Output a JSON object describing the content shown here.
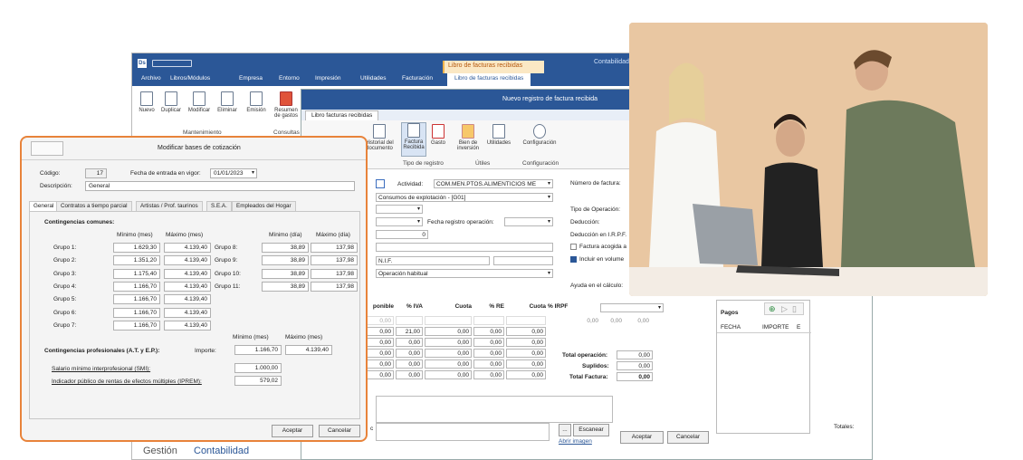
{
  "app": {
    "title": "Contabilidad",
    "context_group": "Libro de facturas recibidas",
    "ribbon_tabs": [
      "Archivo",
      "Libros/Módulos",
      "Empresa",
      "Entorno",
      "Impresión",
      "Utilidades",
      "Facturación",
      "Libro de facturas recibidas"
    ],
    "ribbon_buttons": [
      {
        "label": "Nuevo",
        "icon": "new-doc-icon"
      },
      {
        "label": "Duplicar",
        "icon": "duplicate-icon"
      },
      {
        "label": "Modificar",
        "icon": "edit-icon"
      },
      {
        "label": "Eliminar",
        "icon": "delete-icon"
      },
      {
        "label": "Emisión",
        "icon": "print-icon"
      },
      {
        "label": "Resumen de gastos",
        "icon": "summary-icon"
      }
    ],
    "ribbon_groups": [
      "Mantenimiento",
      "Consultas"
    ],
    "bottom_nav": [
      "Gestión",
      "Contabilidad"
    ]
  },
  "invoice_dialog": {
    "title": "Nuevo registro de factura recibida",
    "tab": "Libro facturas recibidas",
    "ribbon_buttons": [
      {
        "label": "Historial del documento"
      },
      {
        "label": "Factura Recibida"
      },
      {
        "label": "Gasto"
      },
      {
        "label": "Bien de inversión"
      },
      {
        "label": "Utilidades"
      },
      {
        "label": "Configuración"
      }
    ],
    "ribbon_groups": [
      "Tipo de registro",
      "Útiles",
      "Configuración"
    ],
    "actividad_label": "Actividad:",
    "actividad_value": "COM.MEN.PTOS.ALIMENTICIOS ME",
    "concepto_value": "Consumos de explotación - [G01]",
    "fecha_reg_label": "Fecha registro operación:",
    "zero_value": "0",
    "nif_label": "N.I.F.",
    "operacion_value": "Operación habitual",
    "numero_factura_label": "Número de factura:",
    "tipo_operacion_label": "Tipo de Operación:",
    "deduccion_label": "Deducción:",
    "deduccion_irpf_label": "Deducción en I.R.P.F.",
    "factura_acogida_label": "Factura acogida a",
    "incluir_label": "Incluir en volume",
    "ayuda_label": "Ayuda en el cálculo:",
    "tax_headers": [
      "ponible",
      "% IVA",
      "Cuota",
      "% RE",
      "Cuota",
      "% IRPF"
    ],
    "tax_rows": [
      [
        "0,00",
        "",
        "",
        "",
        "",
        ""
      ],
      [
        "0,00",
        "21,00",
        "0,00",
        "0,00",
        "0,00",
        ""
      ],
      [
        "0,00",
        "0,00",
        "0,00",
        "0,00",
        "0,00",
        ""
      ],
      [
        "0,00",
        "0,00",
        "0,00",
        "0,00",
        "0,00",
        ""
      ],
      [
        "0,00",
        "0,00",
        "0,00",
        "0,00",
        "0,00",
        ""
      ],
      [
        "0,00",
        "0,00",
        "0,00",
        "0,00",
        "0,00",
        ""
      ]
    ],
    "irpf_values": [
      "0,00",
      "0,00",
      "0,00"
    ],
    "totals": [
      {
        "label": "Total operación:",
        "value": "0,00"
      },
      {
        "label": "Suplidos:",
        "value": "0,00"
      },
      {
        "label": "Total Factura:",
        "value": "0,00"
      }
    ],
    "pagos_title": "Pagos",
    "pagos_headers": [
      "FECHA",
      "IMPORTE",
      "E"
    ],
    "totales_label": "Totales:",
    "escanear_label": "Escanear",
    "abrir_imagen_label": "Abrir imagen",
    "ellipsis_label": "...",
    "c_label": "c",
    "aceptar_label": "Aceptar",
    "cancelar_label": "Cancelar"
  },
  "bases_dialog": {
    "title": "Modificar bases de cotización",
    "codigo_label": "Código:",
    "codigo_value": "17",
    "fecha_label": "Fecha de entrada en vigor:",
    "fecha_value": "01/01/2023",
    "descripcion_label": "Descripción:",
    "descripcion_value": "General",
    "tabs": [
      "General",
      "Contratos a tiempo parcial",
      "Artistas / Prof. taurinos",
      "S.E.A.",
      "Empleados del Hogar"
    ],
    "comunes_title": "Contingencias comunes:",
    "col_min_mes": "Mínimo (mes)",
    "col_max_mes": "Máximo (mes)",
    "col_min_dia": "Mínimo (día)",
    "col_max_dia": "Máximo (día)",
    "grupos_mes": [
      {
        "label": "Grupo 1:",
        "min": "1.629,30",
        "max": "4.139,40"
      },
      {
        "label": "Grupo 2:",
        "min": "1.351,20",
        "max": "4.139,40"
      },
      {
        "label": "Grupo 3:",
        "min": "1.175,40",
        "max": "4.139,40"
      },
      {
        "label": "Grupo 4:",
        "min": "1.166,70",
        "max": "4.139,40"
      },
      {
        "label": "Grupo 5:",
        "min": "1.166,70",
        "max": "4.139,40"
      },
      {
        "label": "Grupo 6:",
        "min": "1.166,70",
        "max": "4.139,40"
      },
      {
        "label": "Grupo 7:",
        "min": "1.166,70",
        "max": "4.139,40"
      }
    ],
    "grupos_dia": [
      {
        "label": "Grupo 8:",
        "min": "38,89",
        "max": "137,98"
      },
      {
        "label": "Grupo 9:",
        "min": "38,89",
        "max": "137,98"
      },
      {
        "label": "Grupo 10:",
        "min": "38,89",
        "max": "137,98"
      },
      {
        "label": "Grupo 11:",
        "min": "38,89",
        "max": "137,98"
      }
    ],
    "profesionales_title": "Contingencias profesionales (A.T. y E.P.):",
    "importe_label": "Importe:",
    "prof_min": "1.166,70",
    "prof_max": "4.139,40",
    "smi_label": "Salario mínimo interprofesional (SMI):",
    "smi_value": "1.000,00",
    "iprem_label": "Indicador público de rentas de efectos múltiples (IPREM):",
    "iprem_value": "579,02",
    "aceptar_label": "Aceptar",
    "cancelar_label": "Cancelar"
  },
  "colors": {
    "brand": "#2b5797",
    "accent": "#e8833a",
    "context": "#f0b24c",
    "nav_blue": "#2b5797"
  }
}
